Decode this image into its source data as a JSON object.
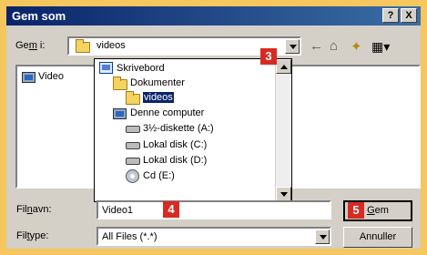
{
  "window": {
    "title": "Gem som",
    "help_label": "?",
    "close_label": "X"
  },
  "location": {
    "label_prefix": "Ge",
    "label_access": "m",
    "label_suffix": " i:",
    "current_folder": "videos"
  },
  "file_list": {
    "items": [
      {
        "label": "Video"
      }
    ]
  },
  "location_dropdown": {
    "items": [
      {
        "label": "Skrivebord",
        "icon": "desktop-icon"
      },
      {
        "label": "Dokumenter",
        "icon": "folder-open-icon"
      },
      {
        "label": "videos",
        "icon": "folder-open-icon",
        "selected": true
      },
      {
        "label": "Denne computer",
        "icon": "computer-icon"
      },
      {
        "label": "3½-diskette (A:)",
        "icon": "floppy-drive-icon"
      },
      {
        "label": "Lokal disk (C:)",
        "icon": "hard-drive-icon"
      },
      {
        "label": "Lokal disk (D:)",
        "icon": "hard-drive-icon"
      },
      {
        "label": "Cd (E:)",
        "icon": "cd-drive-icon"
      }
    ]
  },
  "filename": {
    "label_prefix": "Fil",
    "label_access": "n",
    "label_suffix": "avn:",
    "value": "Video1"
  },
  "filetype": {
    "label_prefix": "Fil",
    "label_access": "t",
    "label_suffix": "ype:",
    "value": "All Files (*.*)"
  },
  "buttons": {
    "save_access": "G",
    "save_suffix": "em",
    "cancel": "Annuller"
  },
  "callouts": {
    "three": "3",
    "four": "4",
    "five": "5"
  },
  "icons": {
    "back": "←",
    "up": "⌂",
    "new_folder": "✦",
    "view": "▦▾"
  },
  "colors": {
    "accent": "#d92a22",
    "title_bar": "#0a246a",
    "selected": "#0a246a",
    "frame": "#f6c65f"
  }
}
